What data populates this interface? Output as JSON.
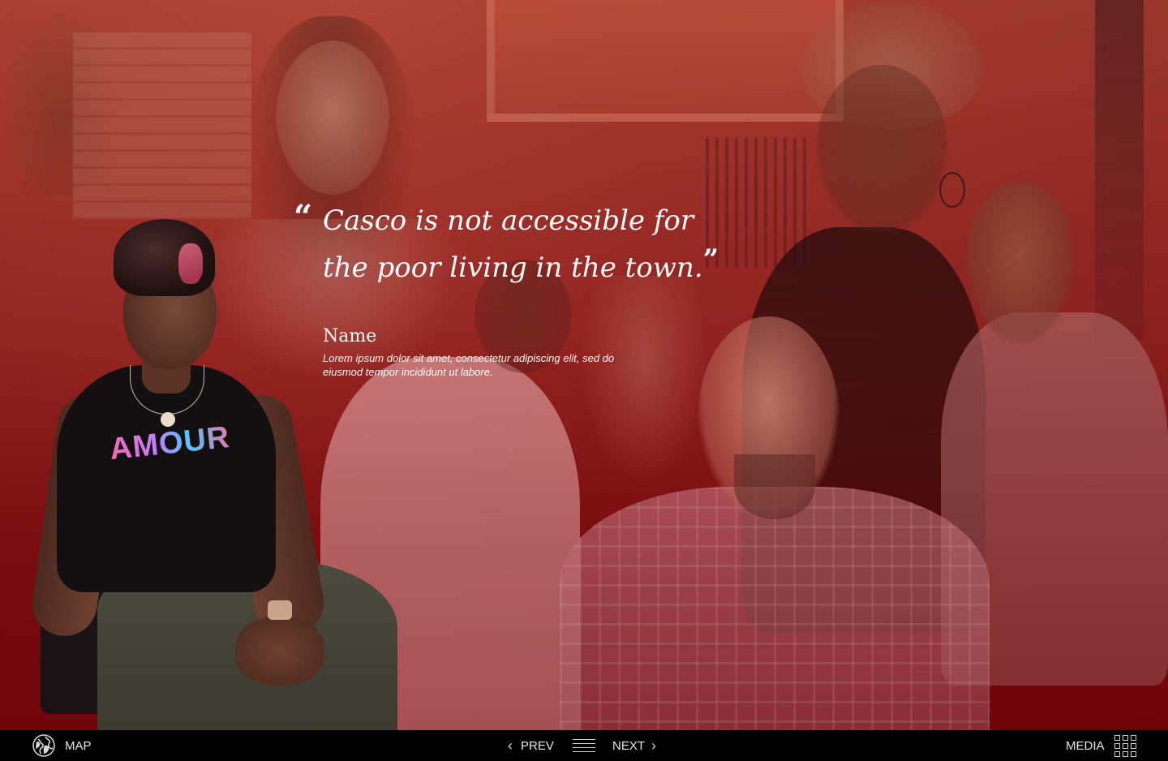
{
  "quote": {
    "open_mark": "“",
    "text": "Casco is not accessible for the poor living in the town.",
    "close_mark": "”",
    "name": "Name",
    "description": "Lorem ipsum dolor sit amet, consectetur adipiscing elit, sed do eiusmod tempor incididunt ut labore."
  },
  "shirt_text": "AMOUR",
  "navbar": {
    "map_label": "MAP",
    "prev_label": "PREV",
    "next_label": "NEXT",
    "media_label": "MEDIA",
    "icons": {
      "map": "globe-icon",
      "prev": "chevron-left-icon",
      "menu": "hamburger-menu-icon",
      "next": "chevron-right-icon",
      "media": "grid-icon"
    }
  },
  "colors": {
    "overlay": "#8c1a1e",
    "navbar_bg": "#000000",
    "text": "#ffffff"
  }
}
